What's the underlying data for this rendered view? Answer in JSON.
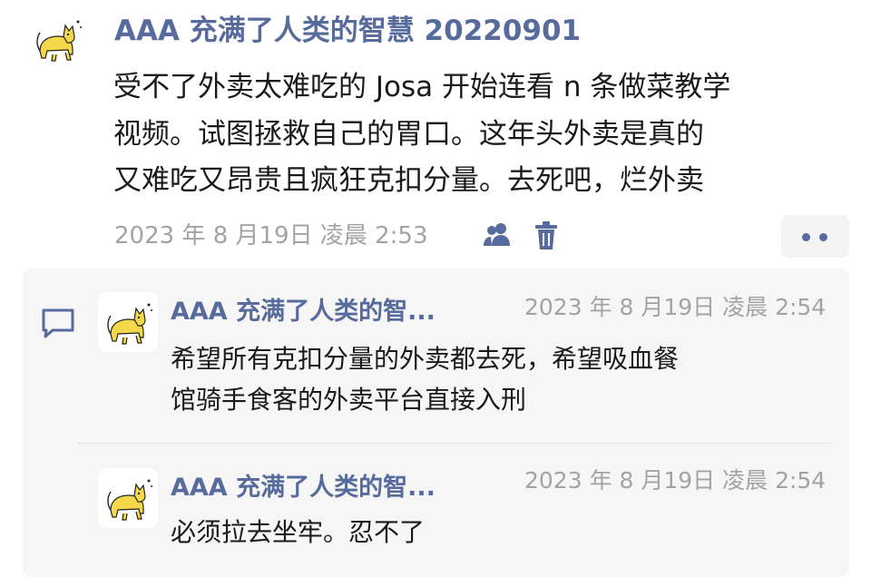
{
  "post": {
    "author": "AAA 充满了人类的智慧 20220901",
    "content_lines": [
      "受不了外卖太难吃的 Josa 开始连看 n 条做菜教学",
      "视频。试图拯救自己的胃口。这年头外卖是真的",
      "又难吃又昂贵且疯狂克扣分量。去死吧，烂外卖"
    ],
    "timestamp": "2023 年 8 月19日 凌晨 2:53"
  },
  "comments": [
    {
      "author": "AAA 充满了人类的智...",
      "timestamp": "2023 年 8 月19日 凌晨 2:54",
      "content_lines": [
        "希望所有克扣分量的外卖都去死，希望吸血餐",
        "馆骑手食客的外卖平台直接入刑"
      ]
    },
    {
      "author": "AAA 充满了人类的智...",
      "timestamp": "2023 年 8 月19日 凌晨 2:54",
      "content_lines": [
        "必须拉去坐牢。忍不了"
      ]
    }
  ],
  "icons": {
    "visibility": "people-icon",
    "delete": "trash-icon",
    "more": "more-dots-icon",
    "comment": "comment-icon"
  },
  "colors": {
    "accent": "#586b9d",
    "meta": "#a3a3a3",
    "comment_bg": "#f6f6f6",
    "avatar_cat": "#f5d84a"
  }
}
